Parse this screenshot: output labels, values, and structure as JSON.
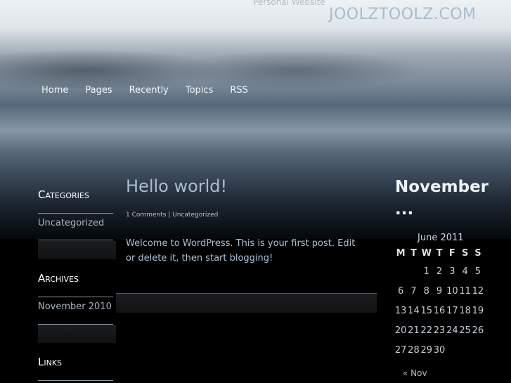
{
  "header": {
    "tagline": "Personal Website",
    "site_title": "JOOLZTOOLZ.COM"
  },
  "nav": [
    "Home",
    "Pages",
    "Recently",
    "Topics",
    "RSS"
  ],
  "sidebar": {
    "categories_title": "Categories",
    "categories": [
      "Uncategorized"
    ],
    "archives_title": "Archives",
    "archives": [
      "November 2010"
    ],
    "links_title": "Links"
  },
  "post": {
    "title": "Hello world!",
    "comments": "1 Comments",
    "sep": "|",
    "category": "Uncategorized",
    "body": "Welcome to WordPress. This is your first post. Edit or delete it, then start blogging!"
  },
  "calendar": {
    "widget_title": "November ...",
    "caption": "June 2011",
    "days": [
      "M",
      "T",
      "W",
      "T",
      "F",
      "S",
      "S"
    ],
    "weeks": [
      [
        "",
        "",
        "1",
        "2",
        "3",
        "4",
        "5"
      ],
      [
        "6",
        "7",
        "8",
        "9",
        "10",
        "11",
        "12"
      ],
      [
        "13",
        "14",
        "15",
        "16",
        "17",
        "18",
        "19"
      ],
      [
        "20",
        "21",
        "22",
        "23",
        "24",
        "25",
        "26"
      ],
      [
        "27",
        "28",
        "29",
        "30",
        "",
        "",
        ""
      ]
    ],
    "prev": "« Nov"
  }
}
